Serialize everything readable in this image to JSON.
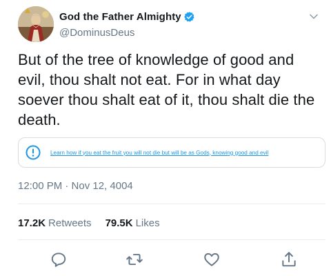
{
  "tweet": {
    "author": {
      "display_name": "God the Father Almighty",
      "handle": "@DominusDeus",
      "verified": true
    },
    "text": "But of the tree of knowledge of good and evil, thou shalt not eat. For in what day soever thou shalt eat of it, thou shalt die the death.",
    "notice": {
      "icon": "info-circle-icon",
      "link_text": "Learn how if you eat the fruit you will not die but will be as Gods, knowing good and evil"
    },
    "timestamp": "12:00 PM · Nov 12, 4004",
    "stats": {
      "retweets_count": "17.2K",
      "retweets_label": "Retweets",
      "likes_count": "79.5K",
      "likes_label": "Likes"
    },
    "actions": [
      "reply-icon",
      "retweet-icon",
      "like-icon",
      "share-icon"
    ]
  },
  "colors": {
    "text": "#14171a",
    "secondary": "#657786",
    "accent": "#1b95e0",
    "border": "#e6ecf0"
  }
}
